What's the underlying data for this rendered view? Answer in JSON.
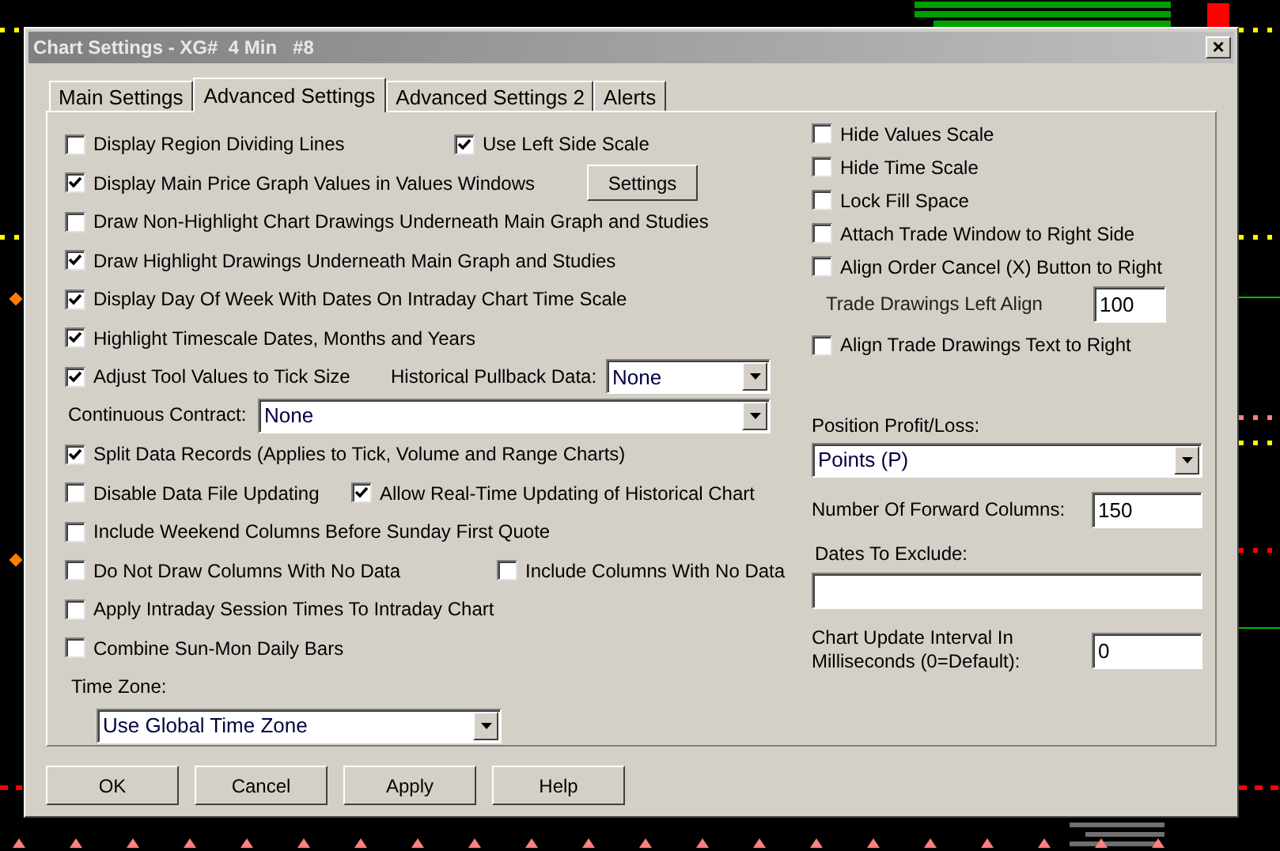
{
  "window": {
    "title": "Chart Settings - XG#  4 Min   #8",
    "close": "×"
  },
  "tabs": [
    {
      "label": "Main Settings",
      "selected": false
    },
    {
      "label": "Advanced Settings",
      "selected": true
    },
    {
      "label": "Advanced Settings 2",
      "selected": false
    },
    {
      "label": "Alerts",
      "selected": false
    }
  ],
  "left_rows": [
    {
      "items": [
        {
          "kind": "checkbox",
          "label": "Display Region Dividing Lines",
          "checked": false
        },
        {
          "kind": "checkbox",
          "label": "Use Left Side Scale",
          "checked": true
        }
      ]
    },
    {
      "items": [
        {
          "kind": "checkbox",
          "label": "Display Main Price Graph Values in Values Windows",
          "checked": true
        },
        {
          "kind": "button",
          "label": "Settings"
        }
      ]
    },
    {
      "items": [
        {
          "kind": "checkbox",
          "label": "Draw Non-Highlight Chart Drawings Underneath Main Graph and Studies",
          "checked": false
        }
      ]
    },
    {
      "items": [
        {
          "kind": "checkbox",
          "label": "Draw Highlight Drawings Underneath Main Graph and Studies",
          "checked": true
        }
      ]
    },
    {
      "items": [
        {
          "kind": "checkbox",
          "label": "Display Day Of Week With Dates On Intraday Chart Time Scale",
          "checked": true
        }
      ]
    },
    {
      "items": [
        {
          "kind": "checkbox",
          "label": "Highlight Timescale Dates, Months and Years",
          "checked": true
        }
      ]
    },
    {
      "items": [
        {
          "kind": "checkbox",
          "label": "Adjust Tool Values to Tick Size",
          "checked": true
        },
        {
          "kind": "label",
          "label": "Historical Pullback Data:"
        },
        {
          "kind": "select",
          "value": "None"
        }
      ]
    },
    {
      "items": [
        {
          "kind": "label",
          "label": "Continuous Contract:"
        },
        {
          "kind": "select",
          "value": "None"
        }
      ]
    },
    {
      "items": [
        {
          "kind": "checkbox",
          "label": "Split Data Records (Applies to Tick, Volume and Range Charts)",
          "checked": true
        }
      ]
    },
    {
      "items": [
        {
          "kind": "checkbox",
          "label": "Disable Data File Updating",
          "checked": false
        },
        {
          "kind": "checkbox",
          "label": "Allow Real-Time Updating of Historical Chart",
          "checked": true
        }
      ]
    },
    {
      "items": [
        {
          "kind": "checkbox",
          "label": "Include Weekend Columns Before Sunday First Quote",
          "checked": false
        }
      ]
    },
    {
      "items": [
        {
          "kind": "checkbox",
          "label": "Do Not Draw Columns With No Data",
          "checked": false
        },
        {
          "kind": "checkbox",
          "label": "Include Columns With No Data",
          "checked": false
        }
      ]
    },
    {
      "items": [
        {
          "kind": "checkbox",
          "label": "Apply Intraday Session Times To Intraday Chart",
          "checked": false
        }
      ]
    },
    {
      "items": [
        {
          "kind": "checkbox",
          "label": "Combine Sun-Mon Daily Bars",
          "checked": false
        }
      ]
    },
    {
      "items": [
        {
          "kind": "label",
          "label": "Time Zone:"
        }
      ]
    },
    {
      "items": [
        {
          "kind": "select",
          "value": "Use Global Time Zone"
        }
      ]
    }
  ],
  "right_rows": [
    {
      "items": [
        {
          "kind": "checkbox",
          "label": "Hide Values Scale",
          "checked": false
        }
      ]
    },
    {
      "items": [
        {
          "kind": "checkbox",
          "label": "Hide Time Scale",
          "checked": false
        }
      ]
    },
    {
      "items": [
        {
          "kind": "checkbox",
          "label": "Lock Fill Space",
          "checked": false
        }
      ]
    },
    {
      "items": [
        {
          "kind": "checkbox",
          "label": "Attach Trade Window to Right Side",
          "checked": false
        }
      ]
    },
    {
      "items": [
        {
          "kind": "checkbox",
          "label": "Align Order Cancel (X) Button to Right",
          "checked": false
        }
      ]
    },
    {
      "items": [
        {
          "kind": "label",
          "label": "Trade Drawings Left Align"
        },
        {
          "kind": "input",
          "value": "100"
        }
      ]
    },
    {
      "items": [
        {
          "kind": "checkbox",
          "label": "Align Trade Drawings Text to Right",
          "checked": false
        }
      ]
    },
    {
      "items": [
        {
          "kind": "label",
          "label": "Position Profit/Loss:"
        }
      ]
    },
    {
      "items": [
        {
          "kind": "select",
          "value": "Points (P)"
        }
      ]
    },
    {
      "items": [
        {
          "kind": "label",
          "label": "Number Of Forward Columns:"
        },
        {
          "kind": "input",
          "value": "150"
        }
      ]
    },
    {
      "items": [
        {
          "kind": "label",
          "label": "Dates To Exclude:"
        }
      ]
    },
    {
      "items": [
        {
          "kind": "input"
        }
      ]
    },
    {
      "items": [
        {
          "kind": "label",
          "label": "Chart Update Interval In Milliseconds (0=Default):"
        },
        {
          "kind": "input",
          "value": "0"
        }
      ]
    }
  ],
  "buttons": [
    "OK",
    "Cancel",
    "Apply",
    "Help"
  ]
}
